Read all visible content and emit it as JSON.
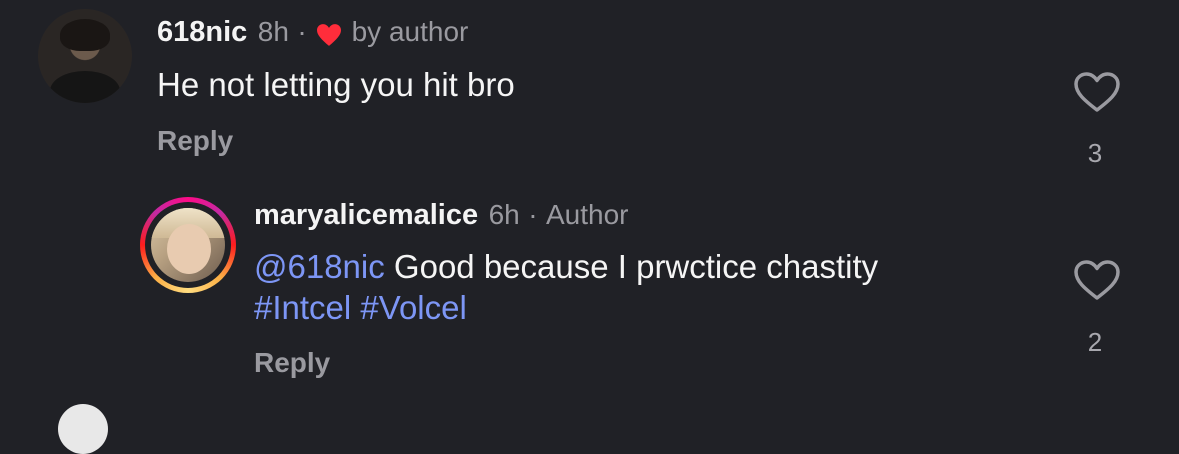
{
  "comment": {
    "username": "618nic",
    "time": "8h",
    "separator": "·",
    "liked_by": "by author",
    "text": "He not letting you hit bro",
    "reply_label": "Reply",
    "like_count": "3"
  },
  "reply": {
    "username": "maryalicemalice",
    "time": "6h",
    "separator": "·",
    "badge": "Author",
    "mention": "@618nic",
    "text": " Good because I prwctice chastity",
    "hashtag1": "#Intcel",
    "hashtag2": "#Volcel",
    "reply_label": "Reply",
    "like_count": "2"
  },
  "colors": {
    "background": "#202126",
    "link": "#7d96f5",
    "heart_red": "#ff2d3b"
  },
  "icons": [
    "heart-outline-icon",
    "heart-filled-icon"
  ]
}
